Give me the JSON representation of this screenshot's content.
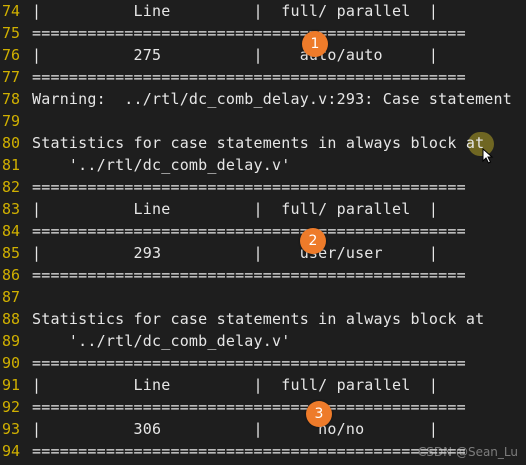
{
  "lines": [
    {
      "num": "74",
      "text": "|          Line         |  full/ parallel  |"
    },
    {
      "num": "75",
      "text": "==============================================="
    },
    {
      "num": "76",
      "text": "|          275          |    auto/auto     |"
    },
    {
      "num": "77",
      "text": "==============================================="
    },
    {
      "num": "78",
      "text": "Warning:  ../rtl/dc_comb_delay.v:293: Case statement"
    },
    {
      "num": "79",
      "text": ""
    },
    {
      "num": "80",
      "text": "Statistics for case statements in always block at"
    },
    {
      "num": "81",
      "text": "    '../rtl/dc_comb_delay.v'"
    },
    {
      "num": "82",
      "text": "==============================================="
    },
    {
      "num": "83",
      "text": "|          Line         |  full/ parallel  |"
    },
    {
      "num": "84",
      "text": "==============================================="
    },
    {
      "num": "85",
      "text": "|          293          |    user/user     |"
    },
    {
      "num": "86",
      "text": "==============================================="
    },
    {
      "num": "87",
      "text": ""
    },
    {
      "num": "88",
      "text": "Statistics for case statements in always block at"
    },
    {
      "num": "89",
      "text": "    '../rtl/dc_comb_delay.v'"
    },
    {
      "num": "90",
      "text": "==============================================="
    },
    {
      "num": "91",
      "text": "|          Line         |  full/ parallel  |"
    },
    {
      "num": "92",
      "text": "==============================================="
    },
    {
      "num": "93",
      "text": "|          306          |      no/no       |"
    },
    {
      "num": "94",
      "text": "==============================================="
    }
  ],
  "badges": [
    "1",
    "2",
    "3"
  ],
  "watermark": "CSDN @Sean_Lu",
  "colors": {
    "background": "#1e1e1e",
    "line_number": "#d0b000",
    "text": "#e6e6e6",
    "badge": "#ee7b2a"
  }
}
